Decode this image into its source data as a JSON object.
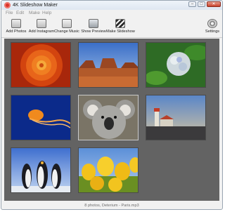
{
  "window": {
    "title": "4K Slideshow Maker"
  },
  "window_controls": {
    "minimize": "–",
    "maximize": "□",
    "close": "✕"
  },
  "menu": [
    "File",
    "Edit",
    "Make",
    "Help"
  ],
  "toolbar": {
    "add_photos": "Add Photos",
    "add_instagram": "Add Instagram",
    "change_music": "Change Music",
    "show_preview": "Show Preview",
    "make_slideshow": "Make Slideshow",
    "settings": "Settings"
  },
  "photos": [
    {
      "subject": "orange-flower",
      "selected": false
    },
    {
      "subject": "desert-mesa",
      "selected": false
    },
    {
      "subject": "hydrangea",
      "selected": false
    },
    {
      "subject": "jellyfish",
      "selected": false
    },
    {
      "subject": "koala",
      "selected": true
    },
    {
      "subject": "lighthouse",
      "selected": false
    },
    {
      "subject": "penguins",
      "selected": false
    },
    {
      "subject": "tulips",
      "selected": false
    }
  ],
  "status": "8 photos, Deterium - Paris.mp3"
}
